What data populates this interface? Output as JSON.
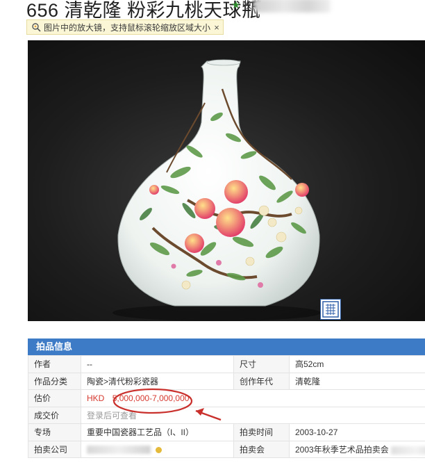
{
  "header": {
    "title": "656 清乾隆 粉彩九桃天球瓶",
    "favorite_label": "收藏"
  },
  "tip": {
    "text": "图片中的放大镜，支持鼠标滚轮缩放区域大小",
    "close": "×"
  },
  "section": {
    "title": "拍品信息"
  },
  "details": {
    "author_label": "作者",
    "author_value": "--",
    "size_label": "尺寸",
    "size_value": "高52cm",
    "category_label": "作品分类",
    "category_value": "陶瓷>清代粉彩瓷器",
    "year_label": "创作年代",
    "year_value": "清乾隆",
    "estimate_label": "估价",
    "estimate_currency": "HKD",
    "estimate_value": "5,000,000-7,000,000",
    "deal_label": "成交价",
    "deal_value": "登录后可查看",
    "session_label": "专场",
    "session_value": "重要中国瓷器工艺品（I、II）",
    "date_label": "拍卖时间",
    "date_value": "2003-10-27",
    "company_label": "拍卖公司",
    "auction_label": "拍卖会",
    "auction_value": "2003年秋季艺术品拍卖会"
  },
  "colors": {
    "header_bar": "#3d7bc6",
    "annotation": "#c9302c",
    "tip_bg": "#fbf7d6"
  }
}
